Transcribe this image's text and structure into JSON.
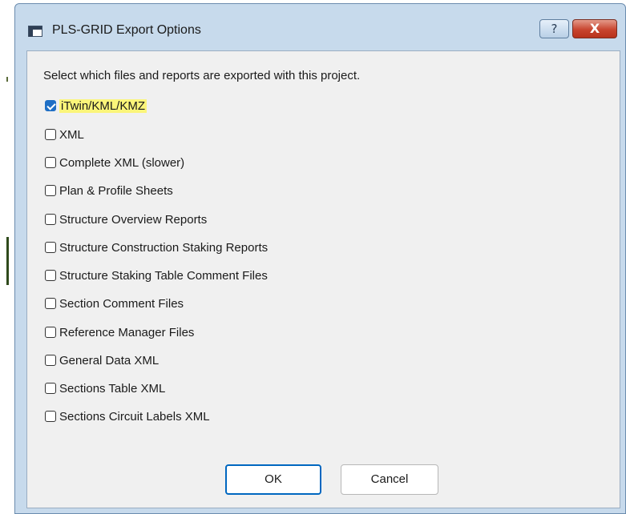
{
  "window": {
    "title": "PLS-GRID Export Options",
    "help_label": "?",
    "close_label": "X"
  },
  "dialog": {
    "instruction": "Select which files and reports are exported with this project.",
    "options": [
      {
        "label": "iTwin/KML/KMZ",
        "checked": true,
        "highlighted": true
      },
      {
        "label": "XML",
        "checked": false
      },
      {
        "label": "Complete XML (slower)",
        "checked": false
      },
      {
        "label": "Plan & Profile Sheets",
        "checked": false
      },
      {
        "label": "Structure Overview Reports",
        "checked": false
      },
      {
        "label": "Structure Construction Staking Reports",
        "checked": false
      },
      {
        "label": "Structure Staking Table Comment Files",
        "checked": false
      },
      {
        "label": "Section Comment Files",
        "checked": false
      },
      {
        "label": "Reference Manager Files",
        "checked": false
      },
      {
        "label": "General Data XML",
        "checked": false
      },
      {
        "label": "Sections Table XML",
        "checked": false
      },
      {
        "label": "Sections Circuit Labels XML",
        "checked": false
      }
    ],
    "ok_label": "OK",
    "cancel_label": "Cancel"
  },
  "colors": {
    "window_frame": "#c7daec",
    "checkbox_accent": "#1f6fc5",
    "highlight": "#fbf57a",
    "close_button": "#c8452f",
    "ok_focus": "#0067c0"
  }
}
